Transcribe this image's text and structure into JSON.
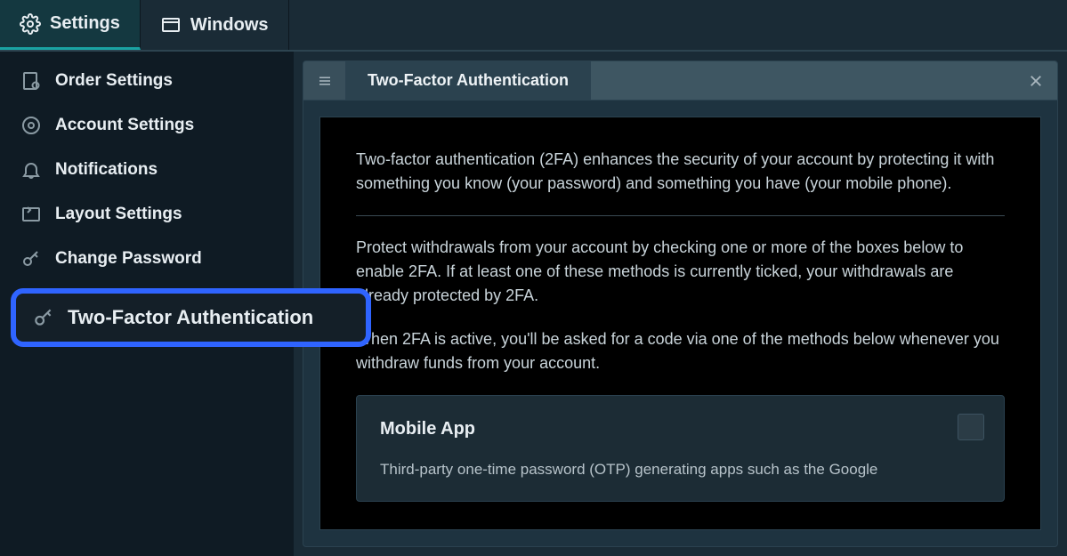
{
  "topbar": {
    "tabs": [
      {
        "label": "Settings",
        "active": true
      },
      {
        "label": "Windows",
        "active": false
      }
    ]
  },
  "sidebar": {
    "items": [
      {
        "label": "Order Settings"
      },
      {
        "label": "Account Settings"
      },
      {
        "label": "Notifications"
      },
      {
        "label": "Layout Settings"
      },
      {
        "label": "Change Password"
      },
      {
        "label": "Two-Factor Authentication"
      }
    ]
  },
  "panel": {
    "title": "Two-Factor Authentication",
    "intro": "Two-factor authentication (2FA) enhances the security of your account by protecting it with something you know (your password) and something you have (your mobile phone).",
    "protect": "Protect withdrawals from your account by checking one or more of the boxes below to enable 2FA. If at least one of these methods is currently ticked, your withdrawals are already protected by 2FA.",
    "when": "When 2FA is active, you'll be asked for a code via one of the methods below whenever you withdraw funds from your account.",
    "option": {
      "title": "Mobile App",
      "text": "Third-party one-time password (OTP) generating apps such as the Google"
    }
  }
}
